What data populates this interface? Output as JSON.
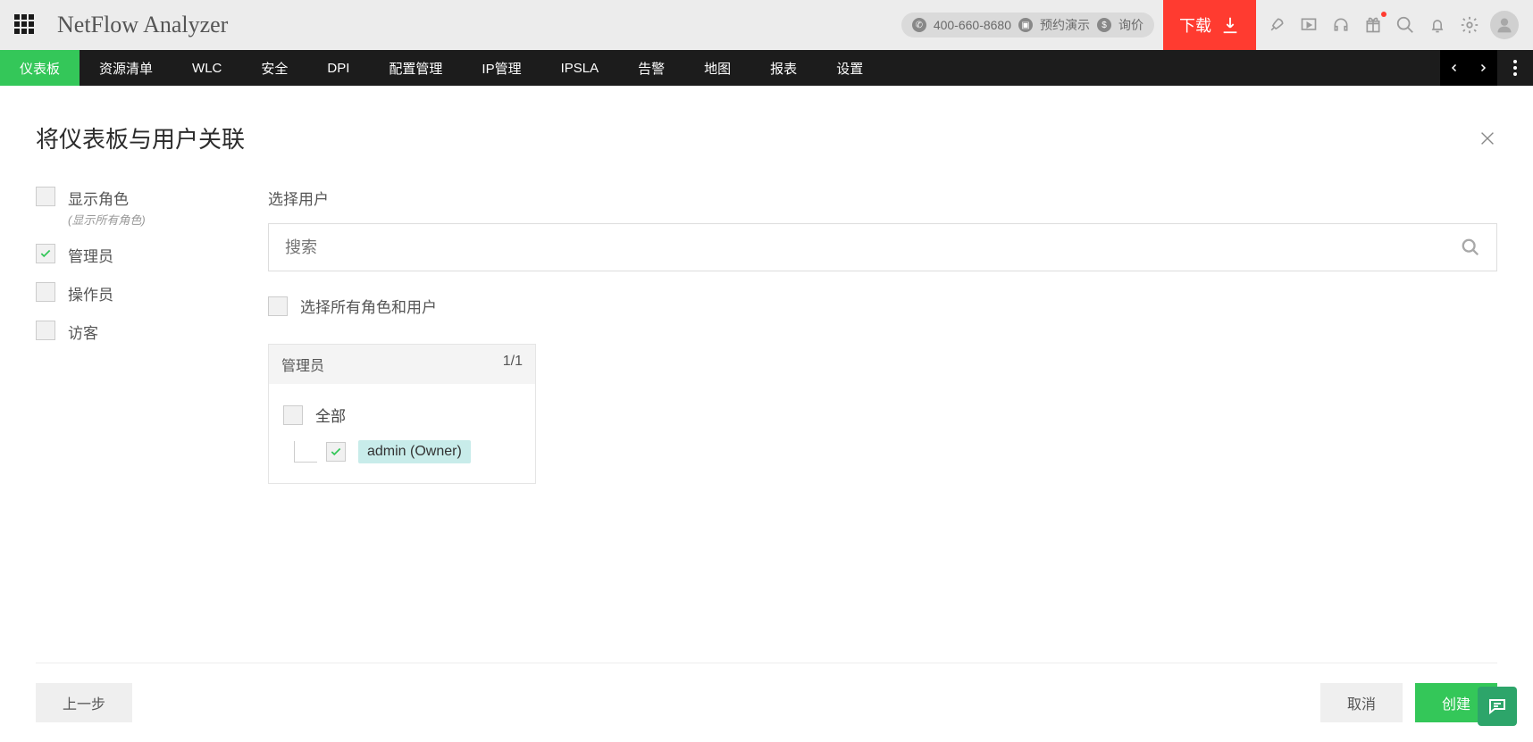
{
  "header": {
    "app_title": "NetFlow Analyzer",
    "phone": "400-660-8680",
    "demo_label": "预约演示",
    "price_label": "询价",
    "download_label": "下载"
  },
  "nav": {
    "items": [
      "仪表板",
      "资源清单",
      "WLC",
      "安全",
      "DPI",
      "配置管理",
      "IP管理",
      "IPSLA",
      "告警",
      "地图",
      "报表",
      "设置"
    ]
  },
  "page": {
    "title": "将仪表板与用户关联"
  },
  "roles": {
    "show_roles_label": "显示角色",
    "show_roles_sub": "(显示所有角色)",
    "items": [
      {
        "label": "管理员",
        "checked": true
      },
      {
        "label": "操作员",
        "checked": false
      },
      {
        "label": "访客",
        "checked": false
      }
    ]
  },
  "main": {
    "select_user_label": "选择用户",
    "search_placeholder": "搜索",
    "select_all_label": "选择所有角色和用户",
    "group_title": "管理员",
    "group_count": "1/1",
    "all_label": "全部",
    "user_label": "admin (Owner)"
  },
  "footer": {
    "back": "上一步",
    "cancel": "取消",
    "create": "创建"
  }
}
